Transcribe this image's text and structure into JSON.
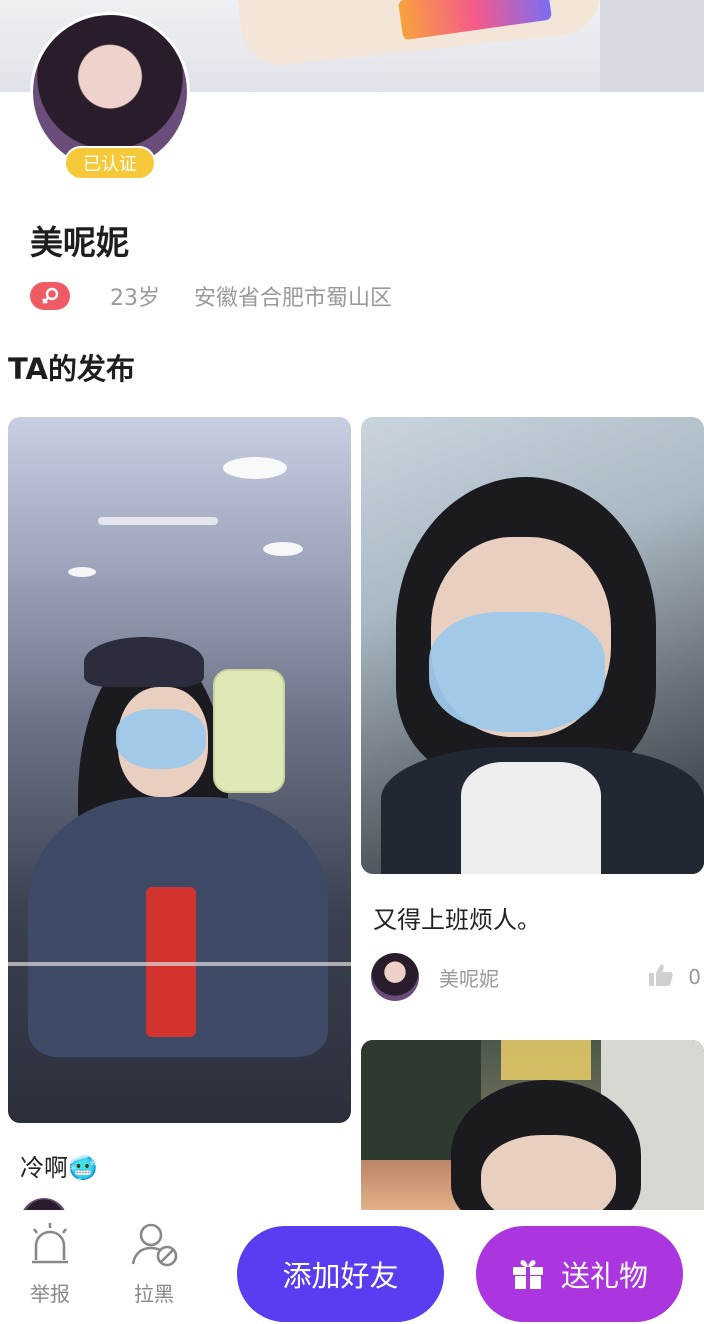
{
  "profile": {
    "verified_badge": "已认证",
    "name": "美呢妮",
    "age": "23岁",
    "location": "安徽省合肥市蜀山区",
    "gender_icon": "female-icon",
    "accent_gender_color": "#ef5b63"
  },
  "section": {
    "title": "TA的发布"
  },
  "posts": [
    {
      "caption": "冷啊🥶",
      "author": "",
      "likes": ""
    },
    {
      "caption": "又得上班烦人。",
      "author": "美呢妮",
      "likes": "0"
    },
    {
      "caption": "",
      "author": "",
      "likes": ""
    }
  ],
  "bottom_bar": {
    "report_label": "举报",
    "block_label": "拉黑",
    "add_friend_label": "添加好友",
    "send_gift_label": "送礼物",
    "add_friend_color": "#5a3df0",
    "send_gift_color": "#ab36e0"
  },
  "icons": {
    "report": "alarm-icon",
    "block": "block-user-icon",
    "gift": "gift-icon",
    "like": "thumbs-up-icon"
  }
}
